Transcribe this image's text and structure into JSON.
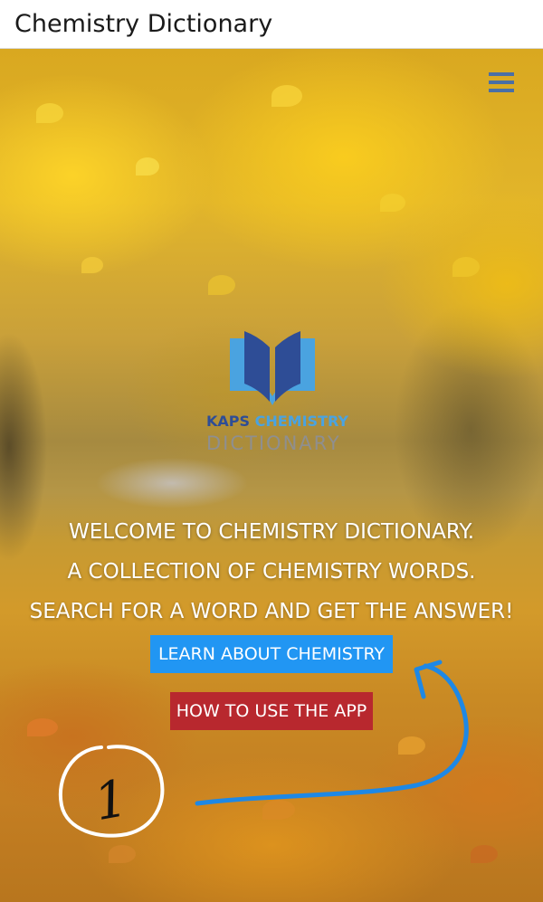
{
  "app_bar": {
    "title": "Chemistry Dictionary"
  },
  "header": {
    "menu_icon": "hamburger-menu-icon"
  },
  "logo": {
    "line1_part1": "KAPS",
    "line1_part2": "CHEMISTRY",
    "line2": "DICTIONARY",
    "colors": {
      "book_dark": "#2e4d96",
      "book_light": "#4aa3e0",
      "kaps": "#2e4d96",
      "chemistry": "#4aa3e0",
      "dictionary": "#8f8f8f"
    }
  },
  "welcome": {
    "lines": [
      "WELCOME TO CHEMISTRY DICTIONARY.",
      "A COLLECTION OF CHEMISTRY WORDS.",
      "SEARCH FOR A WORD AND GET THE ANSWER!"
    ]
  },
  "buttons": {
    "learn_label": "LEARN ABOUT CHEMISTRY",
    "howto_label": "HOW TO USE THE APP",
    "learn_color": "#2196f3",
    "howto_color": "#b8282e"
  },
  "annotation": {
    "number": "1",
    "arrow_color": "#1e88e5"
  }
}
